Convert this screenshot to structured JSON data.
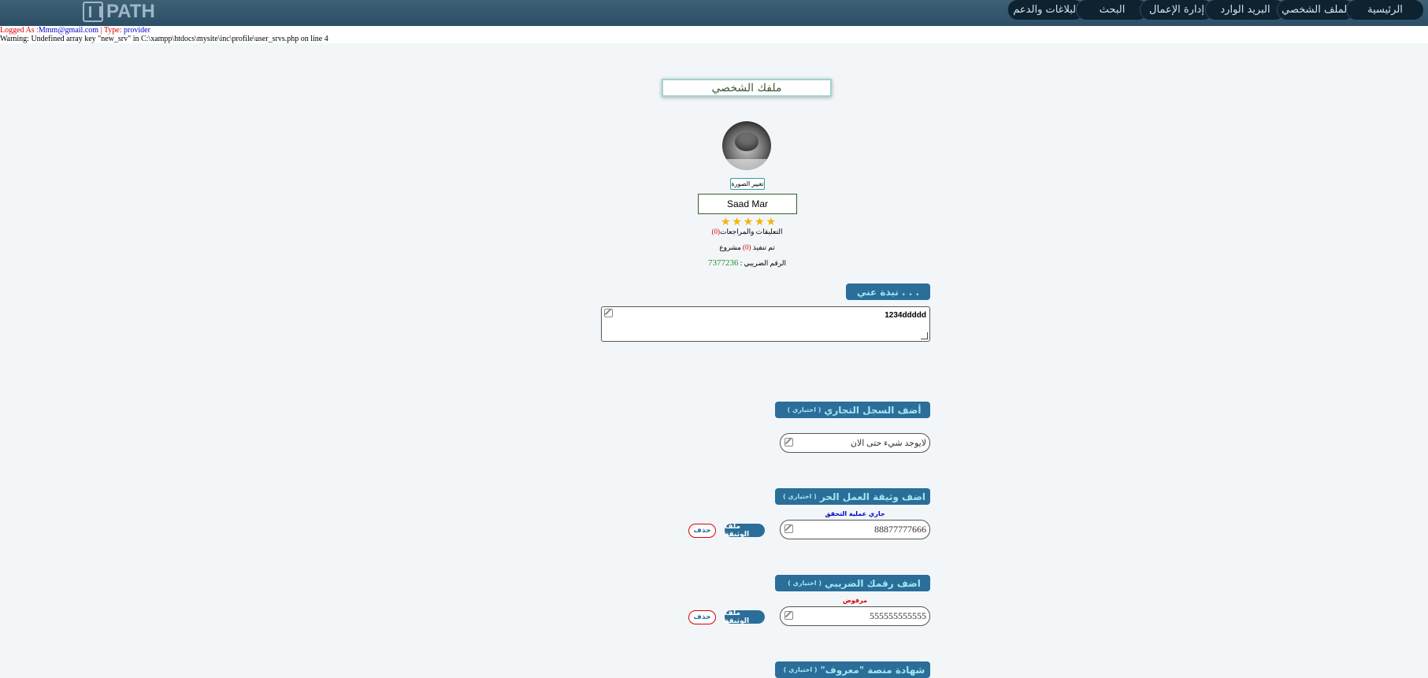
{
  "brand": {
    "logo_text": "PATH"
  },
  "nav": {
    "items": [
      {
        "label": "الرئيسية"
      },
      {
        "label": "الملف الشخصي"
      },
      {
        "label": "البريد الوارد"
      },
      {
        "label": "إدارة الإعمال"
      },
      {
        "label": "البحث"
      },
      {
        "label": "البلاغات والدعم"
      }
    ]
  },
  "status": {
    "logged_as_label": "Logged As :",
    "email": "Mmm@gmail.com",
    "separator": " | ",
    "type_label": "Type: ",
    "type_value": "provider",
    "warning": "Warning: Undefined array key \"new_srv\" in C:\\xampp\\htdocs\\mysite\\inc\\profile\\user_srvs.php on line 4"
  },
  "profile": {
    "title": "ملفك الشخصي",
    "change_photo": "تغيير الصورة",
    "name": "Saad Mar",
    "stars": "★★★★★",
    "reviews_label": "التعليقات والمراجعات",
    "reviews_count": "(0)",
    "projects_prefix": "تم تنفيذ",
    "projects_count": "(0)",
    "projects_suffix": "مشروع",
    "tax_label": "الرقم الضريبي : ",
    "tax_value": "7377236"
  },
  "about": {
    "button": "نبذة عني . . .",
    "text": "1234ddddd"
  },
  "sections": {
    "commercial": {
      "title": "أضف السجل التجاري",
      "optional": "اختياري",
      "value": "لايوجد شيء حتى الان"
    },
    "freelance": {
      "title": "اضف وثيقة العمل الحر",
      "optional": "اختياري",
      "status": "جاري عملية التحقق",
      "value": "88877777666",
      "doc_button": "ملف الوثيقة",
      "delete_button": "حذف"
    },
    "tax": {
      "title": "اضف رقمك الضريبي",
      "optional": "اختياري",
      "status": "مرفوض",
      "value": "555555555555",
      "doc_button": "ملف الوثيقة",
      "delete_button": "حذف"
    },
    "maroof": {
      "title": "شهادة منصة \"معروف\"",
      "optional": "اختياري"
    }
  },
  "colors": {
    "topbar": "#2c4e65",
    "nav_item": "#0f2230",
    "section_button": "#2b6e9a",
    "section_text": "#9fe8ef",
    "status_pending": "#0000cc",
    "status_rejected": "#dd0000"
  },
  "icons": {
    "edit": "edit-icon",
    "star": "star-icon",
    "resize": "resize-handle-icon"
  }
}
